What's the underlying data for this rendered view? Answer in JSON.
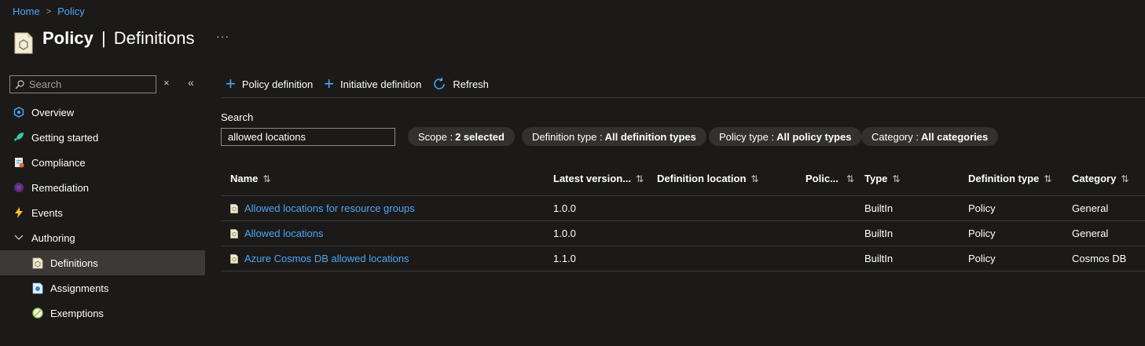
{
  "breadcrumb": {
    "home": "Home",
    "current": "Policy"
  },
  "header": {
    "title_strong": "Policy",
    "separator": "|",
    "title_rest": "Definitions",
    "more": "···"
  },
  "nav": {
    "search_placeholder": "Search",
    "close": "×",
    "collapse": "«",
    "items": [
      {
        "label": "Overview",
        "icon": "overview-icon"
      },
      {
        "label": "Getting started",
        "icon": "rocket-icon"
      },
      {
        "label": "Compliance",
        "icon": "compliance-icon"
      },
      {
        "label": "Remediation",
        "icon": "remediation-icon"
      },
      {
        "label": "Events",
        "icon": "lightning-icon"
      },
      {
        "label": "Authoring",
        "icon": "chevron-down-icon"
      },
      {
        "label": "Definitions",
        "icon": "definition-icon"
      },
      {
        "label": "Assignments",
        "icon": "assignment-icon"
      },
      {
        "label": "Exemptions",
        "icon": "exemption-icon"
      }
    ]
  },
  "toolbar": {
    "policy_definition": "Policy definition",
    "initiative_definition": "Initiative definition",
    "refresh": "Refresh"
  },
  "filters": {
    "search_label": "Search",
    "search_value": "allowed locations",
    "pills": [
      {
        "key": "Scope :",
        "value": "2 selected"
      },
      {
        "key": "Definition type :",
        "value": "All definition types"
      },
      {
        "key": "Policy type :",
        "value": "All policy types"
      },
      {
        "key": "Category :",
        "value": "All categories"
      }
    ]
  },
  "table": {
    "sort_glyph": "⇅",
    "columns": [
      "Name",
      "Latest version...",
      "Definition location",
      "Polic...",
      "Type",
      "Definition type",
      "Category"
    ],
    "rows": [
      {
        "name": "Allowed locations for resource groups",
        "version": "1.0.0",
        "location": "",
        "policies": "",
        "type": "BuiltIn",
        "definition_type": "Policy",
        "category": "General"
      },
      {
        "name": "Allowed locations",
        "version": "1.0.0",
        "location": "",
        "policies": "",
        "type": "BuiltIn",
        "definition_type": "Policy",
        "category": "General"
      },
      {
        "name": "Azure Cosmos DB allowed locations",
        "version": "1.1.0",
        "location": "",
        "policies": "",
        "type": "BuiltIn",
        "definition_type": "Policy",
        "category": "Cosmos DB"
      }
    ]
  },
  "colors": {
    "accent": "#4ba6f5",
    "background": "#1b1a19",
    "selected": "#3b3a39",
    "pill": "#323130"
  }
}
